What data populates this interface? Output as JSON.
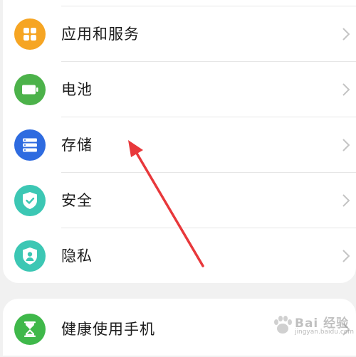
{
  "settings_group_1": {
    "items": [
      {
        "label": "应用和服务",
        "icon": "apps-grid-icon",
        "color": "#f6a523"
      },
      {
        "label": "电池",
        "icon": "battery-icon",
        "color": "#4cb24a"
      },
      {
        "label": "存储",
        "icon": "storage-icon",
        "color": "#2e6be0"
      },
      {
        "label": "安全",
        "icon": "shield-check-icon",
        "color": "#3cc7b4"
      },
      {
        "label": "隐私",
        "icon": "privacy-shield-icon",
        "color": "#3cc7b4"
      }
    ]
  },
  "settings_group_2": {
    "items": [
      {
        "label": "健康使用手机",
        "icon": "hourglass-icon",
        "color": "#3fb84a"
      }
    ]
  },
  "annotation": {
    "arrow_color": "#e8383b"
  },
  "watermark": {
    "brand": "Bai 经验",
    "url": "jingyan.baidu.com"
  }
}
